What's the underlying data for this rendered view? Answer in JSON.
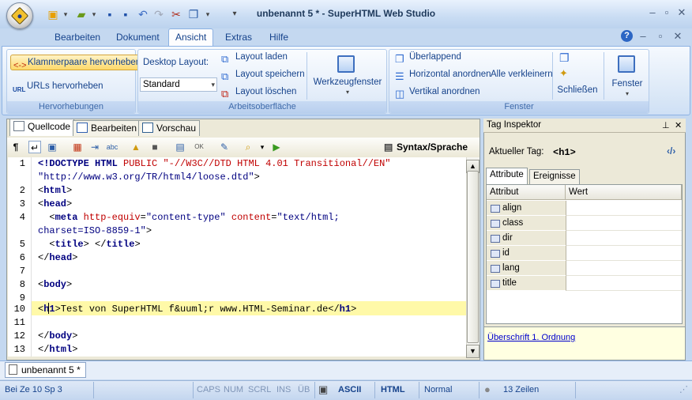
{
  "window": {
    "title": "unbenannt 5 * - SuperHTML Web Studio"
  },
  "ribbon": {
    "tabs": [
      "Bearbeiten",
      "Dokument",
      "Ansicht",
      "Extras",
      "Hilfe"
    ],
    "active_tab": "Ansicht",
    "groups": {
      "hervorhebungen": {
        "caption": "Hervorhebungen",
        "klammer": "Klammerpaare hervorheben",
        "urls": "URLs hervorheben"
      },
      "arbeitsoberflaeche": {
        "caption": "Arbeitsoberfläche",
        "desktop_label": "Desktop Layout:",
        "layout_value": "Standard",
        "laden": "Layout laden",
        "speichern": "Layout speichern",
        "loeschen": "Layout löschen",
        "werkzeugfenster": "Werkzeugfenster"
      },
      "fenster": {
        "caption": "Fenster",
        "ueberlappend": "Überlappend",
        "horizontal": "Horizontal anordnen",
        "vertikal": "Vertikal anordnen",
        "verkleinern": "Alle verkleinern",
        "schliessen": "Schließen",
        "fenster": "Fenster"
      }
    }
  },
  "editor": {
    "tabs": {
      "quellcode": "Quellcode",
      "bearbeiten": "Bearbeiten",
      "vorschau": "Vorschau"
    },
    "syntax_button": "Syntax/Sprache",
    "line_numbers": [
      "1",
      "",
      "2",
      "3",
      "4",
      "",
      "5",
      "6",
      "7",
      "8",
      "9",
      "10",
      "11",
      "12",
      "13"
    ],
    "current_line": 10
  },
  "inspector": {
    "title": "Tag Inspektor",
    "current_tag_label": "Aktueller Tag:",
    "current_tag": "<h1>",
    "tabs": {
      "attribute": "Attribute",
      "ereignisse": "Ereignisse"
    },
    "columns": {
      "attr": "Attribut",
      "value": "Wert"
    },
    "attributes": [
      "align",
      "class",
      "dir",
      "id",
      "lang",
      "title"
    ],
    "description": "Überschrift 1. Ordnung"
  },
  "document_tab": "unbenannt 5 *",
  "status": {
    "line_label": "Bei  Ze 10  Sp 3",
    "caps": "CAPS",
    "num": "NUM",
    "scrl": "SCRL",
    "ins": "INS",
    "ub": "ÜB",
    "encoding": "ASCII",
    "language": "HTML",
    "mode": "Normal",
    "lines": "13 Zeilen"
  },
  "colors": {
    "ribbon_text": "#15428b",
    "tag": "#000080",
    "attribute": "#c00000",
    "highlight": "#fff9a8"
  }
}
